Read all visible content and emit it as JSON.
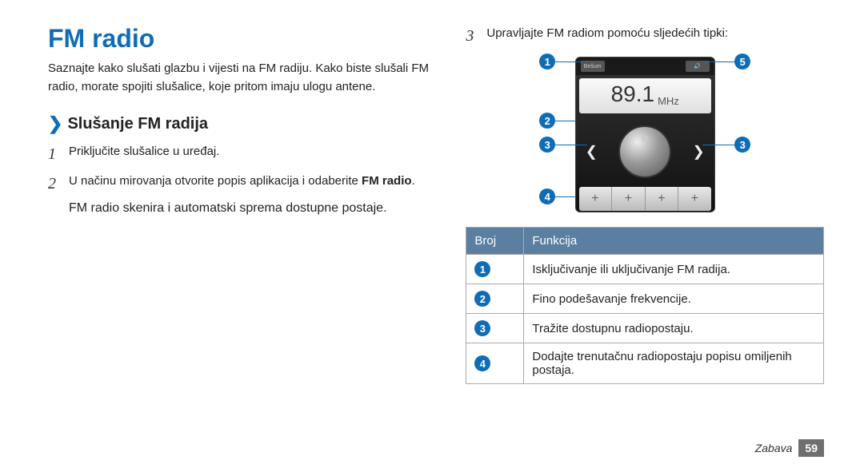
{
  "title": "FM radio",
  "intro": "Saznajte kako slušati glazbu i vijesti na FM radiju. Kako biste slušali FM radio, morate spojiti slušalice, koje pritom imaju ulogu antene.",
  "subhead": "Slušanje FM radija",
  "steps": {
    "s1_num": "1",
    "s1": "Priključite slušalice u uređaj.",
    "s2_num": "2",
    "s2_a": "U načinu mirovanja otvorite popis aplikacija i odaberite ",
    "s2_b": "FM radio",
    "s2_c": ".",
    "s2_note": "FM radio skenira i automatski sprema dostupne postaje.",
    "s3_num": "3",
    "s3": "Upravljajte FM radiom pomoću sljedećih tipki:"
  },
  "radio": {
    "button_top": "Bešum",
    "speaker_glyph": "🔊",
    "frequency": "89.1",
    "unit": "MHz",
    "seek_left": "❮",
    "seek_right": "❯",
    "fav_glyph": "+"
  },
  "callouts": {
    "n1": "1",
    "n2": "2",
    "n3": "3",
    "n4": "4",
    "n5": "5"
  },
  "table": {
    "h1": "Broj",
    "h2": "Funkcija",
    "r1": "Isključivanje ili uključivanje FM radija.",
    "r2": "Fino podešavanje frekvencije.",
    "r3": "Tražite dostupnu radiopostaju.",
    "r4": "Dodajte trenutačnu radiopostaju popisu omiljenih postaja."
  },
  "footer": {
    "section": "Zabava",
    "page": "59"
  }
}
